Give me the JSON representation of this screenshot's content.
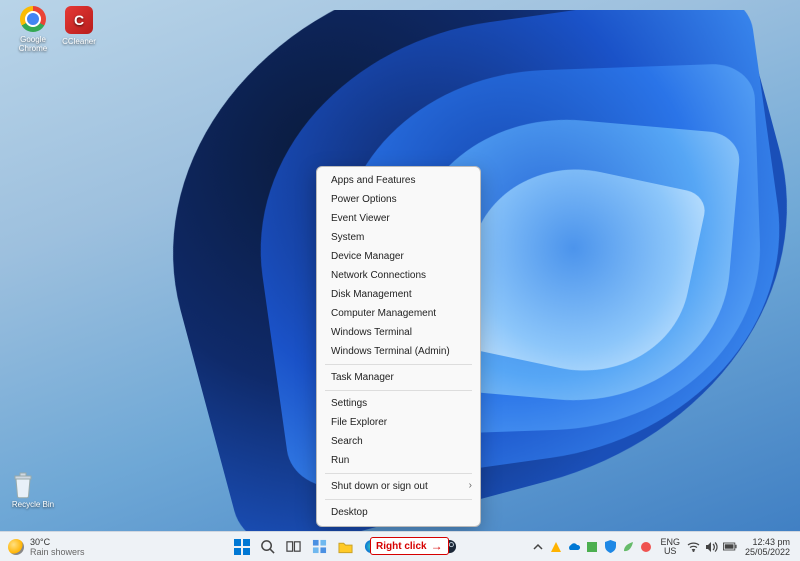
{
  "desktop_icons": {
    "chrome": "Google Chrome",
    "ccleaner": "CCleaner",
    "recycle_bin": "Recycle Bin"
  },
  "context_menu": {
    "items": [
      "Apps and Features",
      "Power Options",
      "Event Viewer",
      "System",
      "Device Manager",
      "Network Connections",
      "Disk Management",
      "Computer Management",
      "Windows Terminal",
      "Windows Terminal (Admin)",
      "Task Manager",
      "Settings",
      "File Explorer",
      "Search",
      "Run"
    ],
    "shutdown": "Shut down or sign out",
    "desktop": "Desktop"
  },
  "annotation": {
    "label": "Right click"
  },
  "taskbar": {
    "weather": {
      "temp": "30°C",
      "desc": "Rain showers"
    },
    "lang": {
      "line1": "ENG",
      "line2": "US"
    },
    "clock": {
      "time": "12:43 pm",
      "date": "25/05/2022"
    }
  }
}
